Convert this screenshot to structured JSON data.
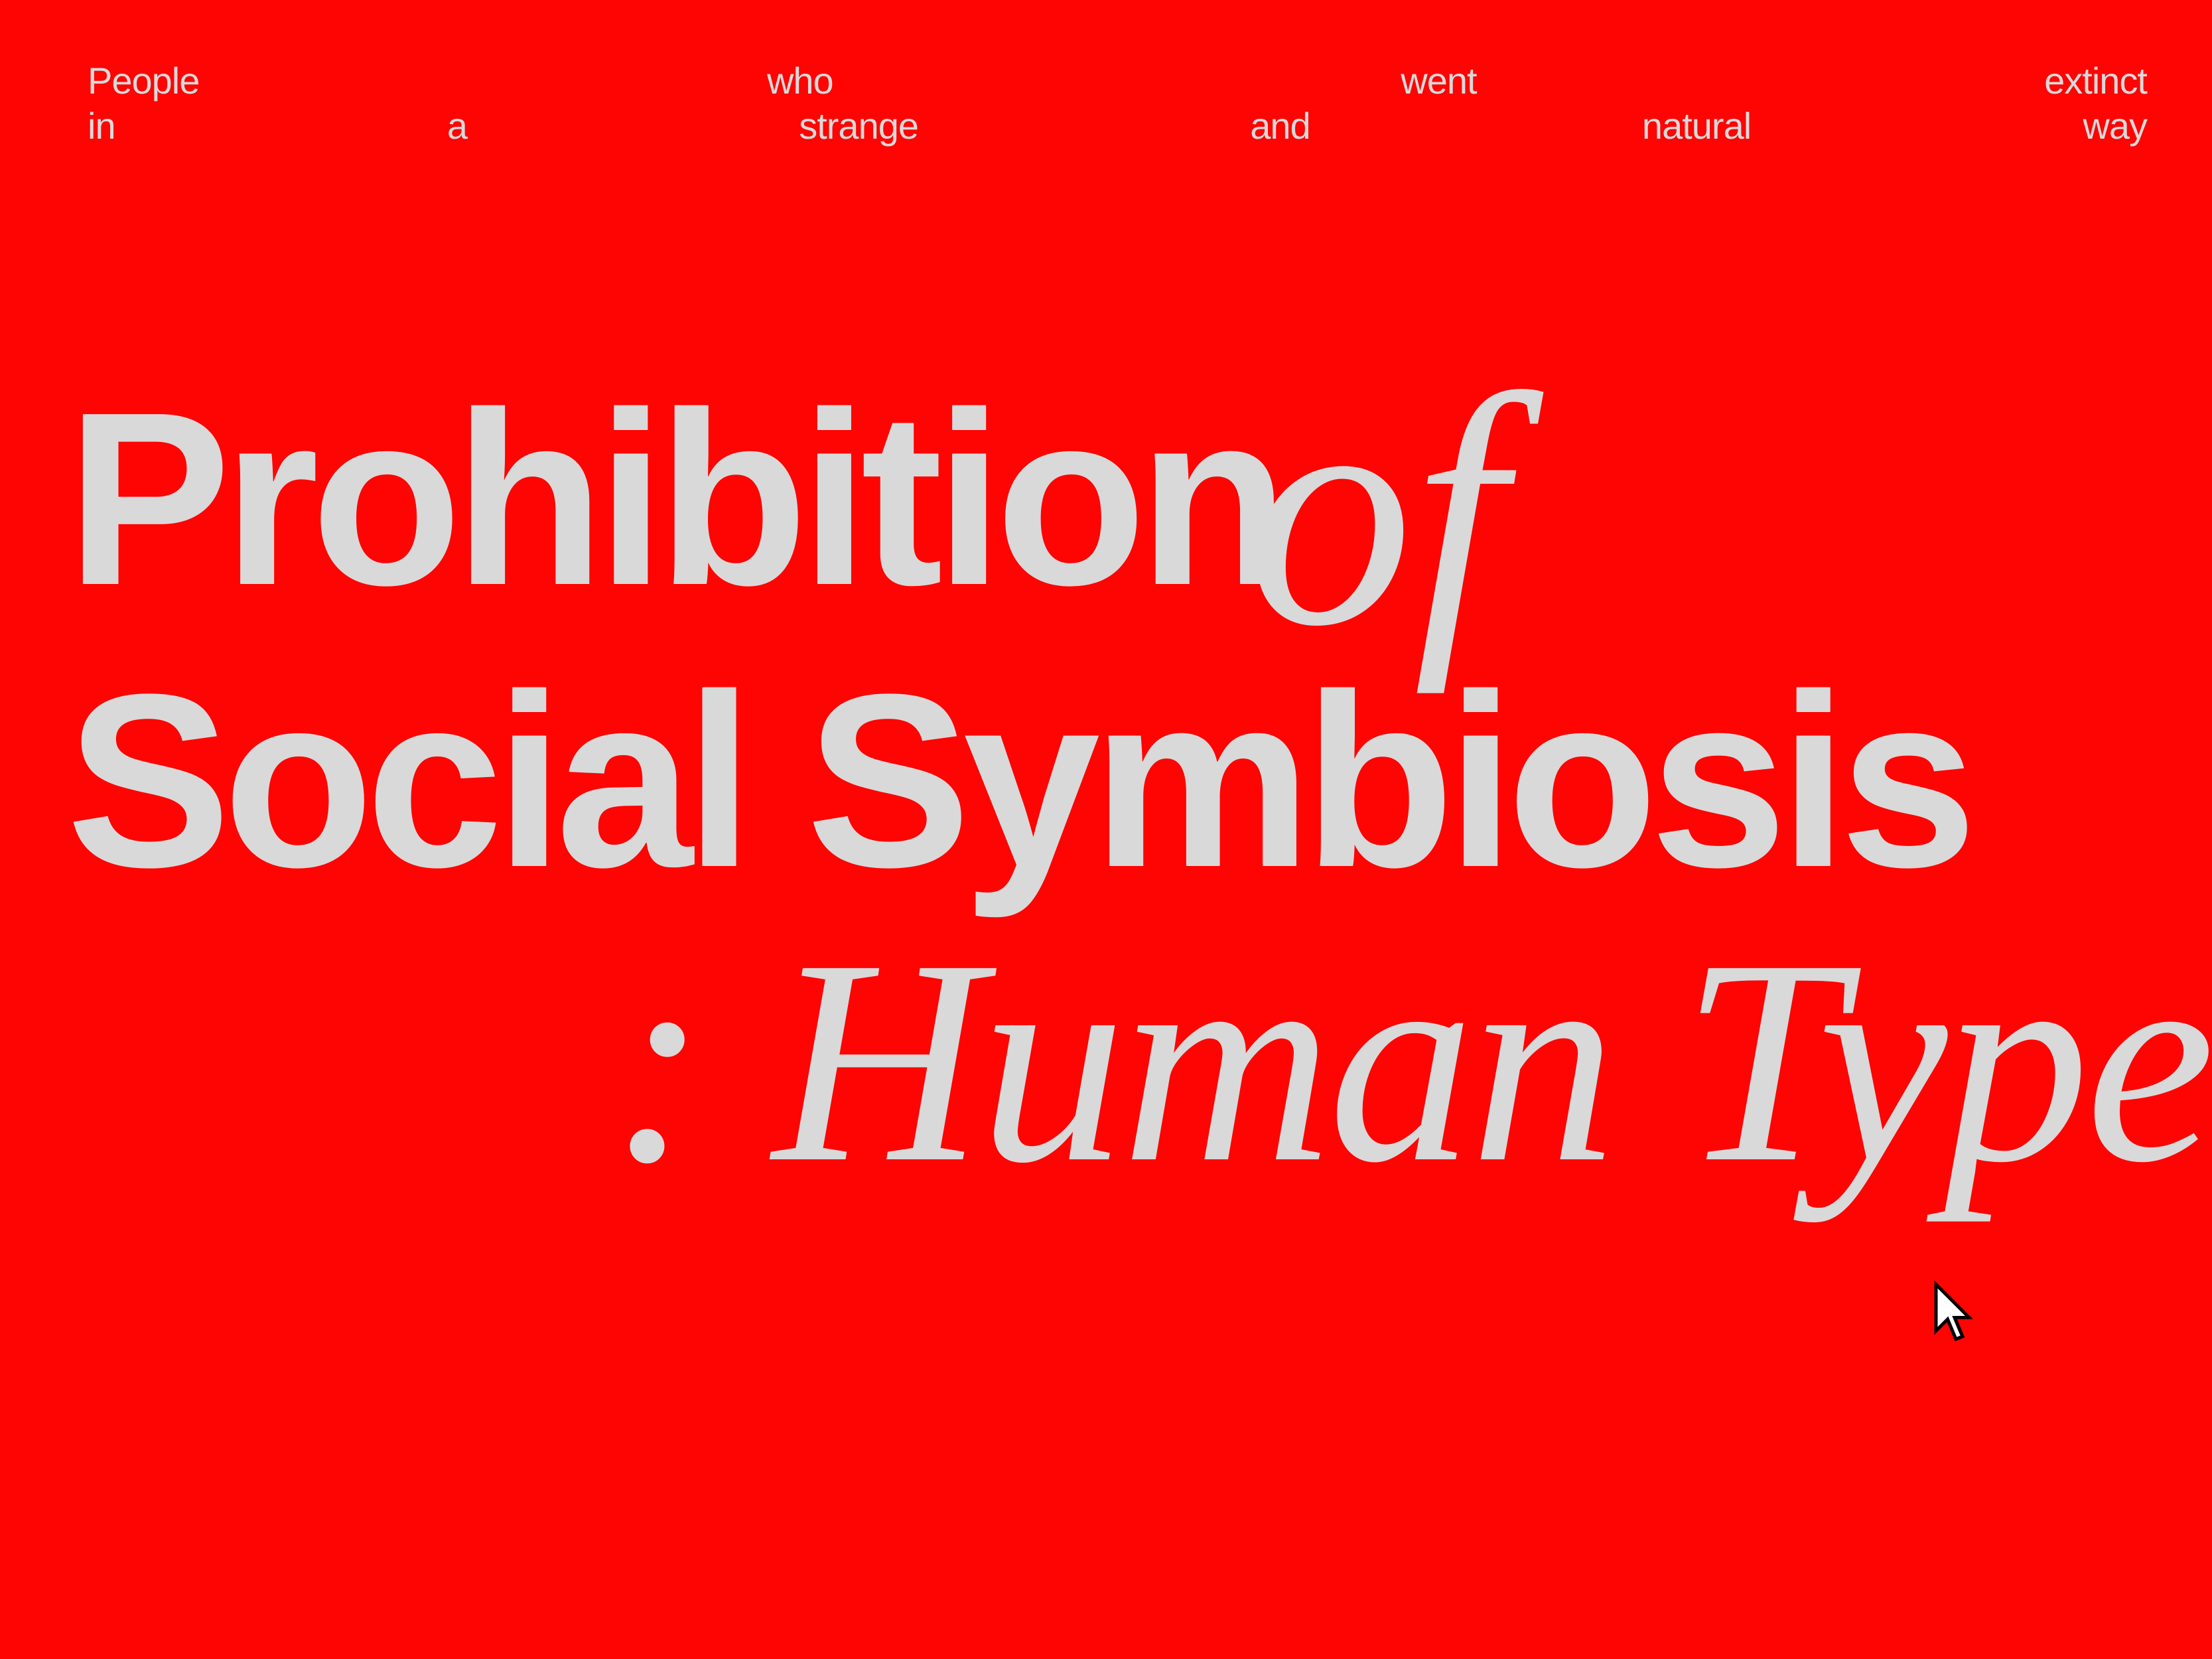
{
  "intro": {
    "line1": [
      "People",
      "who",
      "went",
      "extinct"
    ],
    "line2": [
      "in",
      "a",
      "strange",
      "and",
      "natural",
      "way"
    ]
  },
  "title": {
    "line1": "Prohibition",
    "connector": "of",
    "line2": "Social Symbiosis",
    "subtitle": ": Human Type"
  },
  "colors": {
    "background": "#fe0403",
    "text": "#d9d9d9"
  }
}
